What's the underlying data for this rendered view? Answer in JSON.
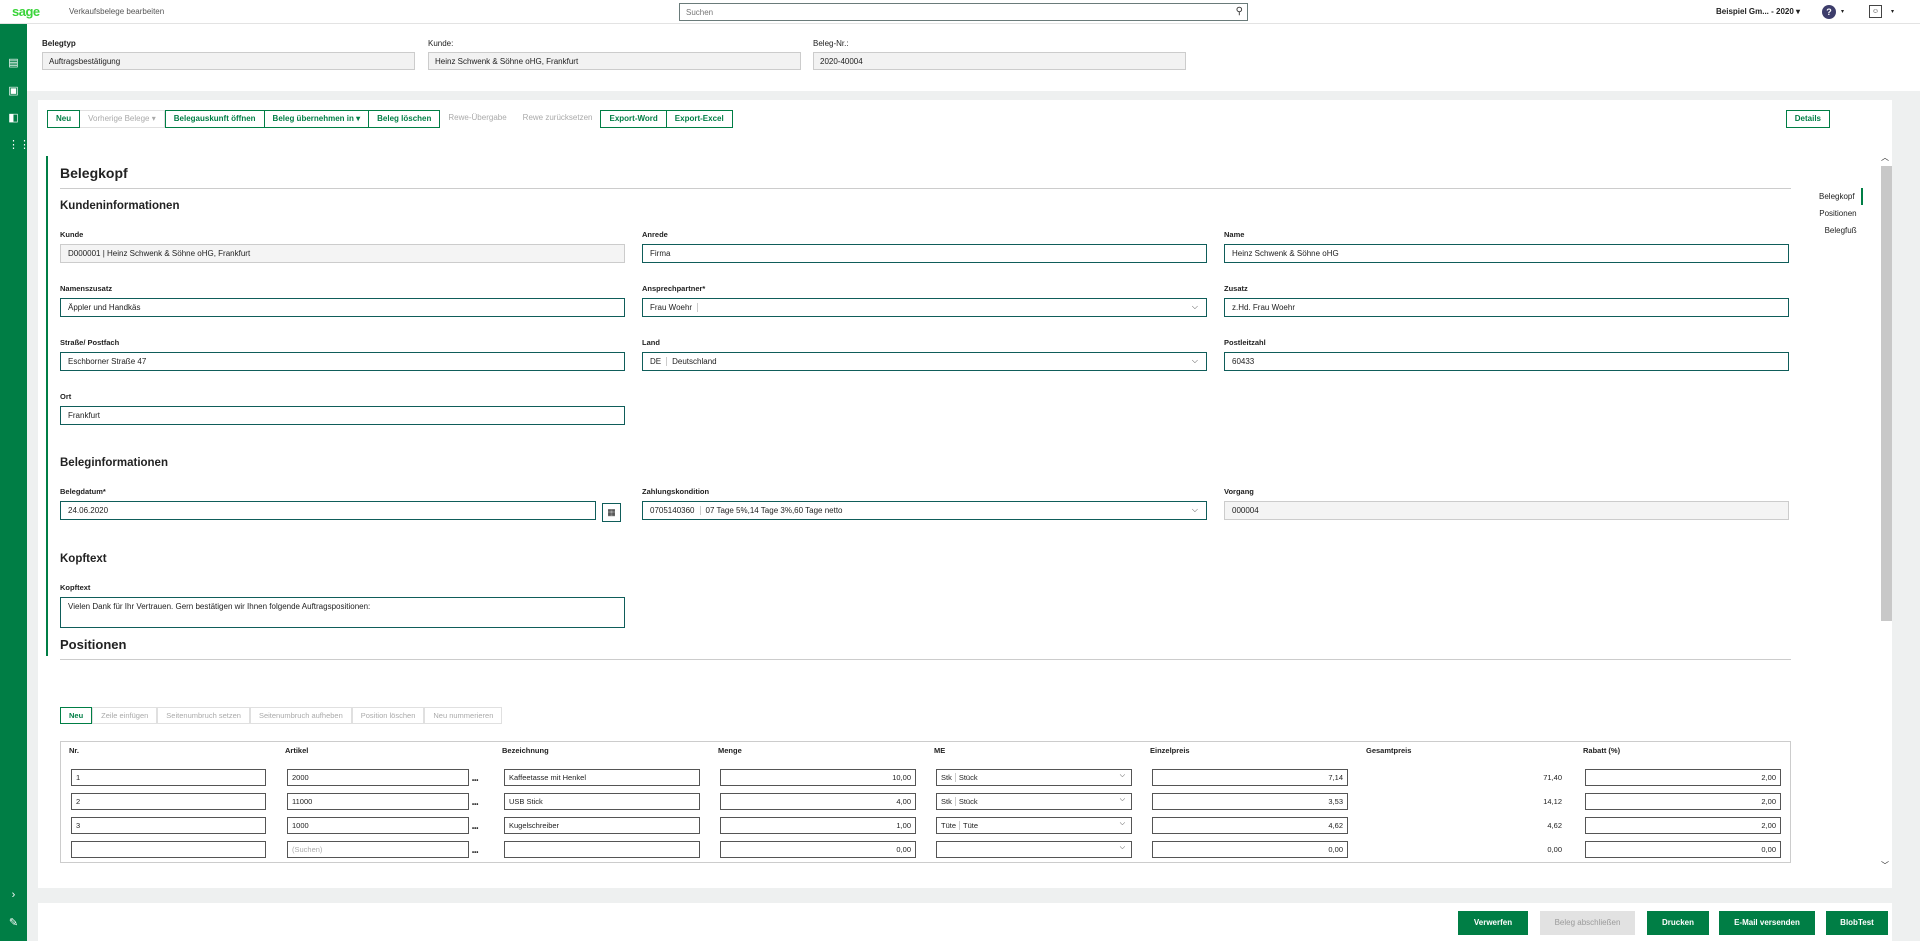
{
  "topbar": {
    "logo": "sage",
    "app_title": "Verkaufsbelege bearbeiten",
    "search_placeholder": "Suchen",
    "company": "Beispiel Gm... - 2020",
    "help": "?"
  },
  "header": {
    "belegtyp_label": "Belegtyp",
    "belegtyp_value": "Auftragsbestätigung",
    "kunde_label": "Kunde:",
    "kunde_value": "Heinz Schwenk & Söhne oHG, Frankfurt",
    "belegnr_label": "Beleg-Nr.:",
    "belegnr_value": "2020-40004"
  },
  "toolbar": {
    "neu": "Neu",
    "vorherige": "Vorherige Belege",
    "belegauskunft": "Belegauskunft öffnen",
    "uebernehmen": "Beleg übernehmen in",
    "loeschen": "Beleg löschen",
    "rewe_uebergabe": "Rewe-Übergabe",
    "rewe_zurueck": "Rewe zurücksetzen",
    "export_word": "Export-Word",
    "export_excel": "Export-Excel",
    "details": "Details"
  },
  "belegkopf": {
    "title": "Belegkopf",
    "kundeninfo_title": "Kundeninformationen",
    "kunde_label": "Kunde",
    "kunde_value": "D000001 | Heinz Schwenk & Söhne oHG, Frankfurt",
    "anrede_label": "Anrede",
    "anrede_value": "Firma",
    "name_label": "Name",
    "name_value": "Heinz Schwenk & Söhne oHG",
    "namenszusatz_label": "Namenszusatz",
    "namenszusatz_value": "Äppler und Handkäs",
    "ansprechpartner_label": "Ansprechpartner*",
    "ansprechpartner_value": "Frau Woehr",
    "zusatz_label": "Zusatz",
    "zusatz_value": "z.Hd. Frau Woehr",
    "strasse_label": "Straße/ Postfach",
    "strasse_value": "Eschborner Straße 47",
    "land_label": "Land",
    "land_code": "DE",
    "land_value": "Deutschland",
    "plz_label": "Postleitzahl",
    "plz_value": "60433",
    "ort_label": "Ort",
    "ort_value": "Frankfurt",
    "beleginfo_title": "Beleginformationen",
    "belegdatum_label": "Belegdatum*",
    "belegdatum_value": "24.06.2020",
    "zahlung_label": "Zahlungskondition",
    "zahlung_code": "0705140360",
    "zahlung_value": "07 Tage 5%,14 Tage 3%,60 Tage netto",
    "vorgang_label": "Vorgang",
    "vorgang_value": "000004",
    "kopftext_title": "Kopftext",
    "kopftext_label": "Kopftext",
    "kopftext_value": "Vielen Dank für Ihr Vertrauen. Gern bestätigen wir Ihnen folgende Auftragspositionen:"
  },
  "anchors": {
    "belegkopf": "Belegkopf",
    "positionen": "Positionen",
    "belegfuss": "Belegfuß"
  },
  "positionen": {
    "title": "Positionen",
    "btn_neu": "Neu",
    "btn_zeile": "Zeile einfügen",
    "btn_seite_setzen": "Seitenumbruch setzen",
    "btn_seite_aufheben": "Seitenumbruch aufheben",
    "btn_pos_loeschen": "Position löschen",
    "btn_neu_nummerieren": "Neu nummerieren",
    "columns": [
      "Nr.",
      "Artikel",
      "Bezeichnung",
      "Menge",
      "ME",
      "Einzelpreis",
      "Gesamtpreis",
      "Rabatt (%)"
    ],
    "rows": [
      {
        "nr": "1",
        "artikel": "2000",
        "bezeichnung": "Kaffeetasse mit Henkel",
        "menge": "10,00",
        "me_code": "Stk",
        "me": "Stück",
        "einzelpreis": "7,14",
        "gesamtpreis": "71,40",
        "rabatt": "2,00"
      },
      {
        "nr": "2",
        "artikel": "11000",
        "bezeichnung": "USB Stick",
        "menge": "4,00",
        "me_code": "Stk",
        "me": "Stück",
        "einzelpreis": "3,53",
        "gesamtpreis": "14,12",
        "rabatt": "2,00"
      },
      {
        "nr": "3",
        "artikel": "1000",
        "bezeichnung": "Kugelschreiber",
        "menge": "1,00",
        "me_code": "Tüte",
        "me": "Tüte",
        "einzelpreis": "4,62",
        "gesamtpreis": "4,62",
        "rabatt": "2,00"
      },
      {
        "nr": "",
        "artikel": "(Suchen)",
        "bezeichnung": "",
        "menge": "0,00",
        "me_code": "",
        "me": "",
        "einzelpreis": "0,00",
        "gesamtpreis": "0,00",
        "rabatt": "0,00"
      }
    ]
  },
  "footer": {
    "verwerfen": "Verwerfen",
    "abschliessen": "Beleg abschließen",
    "drucken": "Drucken",
    "email": "E-Mail versenden",
    "blobtest": "BlobTest"
  }
}
